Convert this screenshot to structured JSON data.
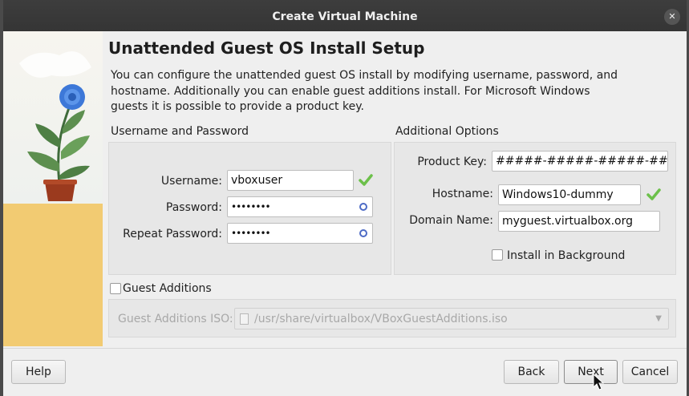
{
  "window": {
    "title": "Create Virtual Machine",
    "close_glyph": "✕"
  },
  "page": {
    "heading": "Unattended Guest OS Install Setup",
    "description": "You can configure the unattended guest OS install by modifying username, password, and hostname. Additionally you can enable guest additions install. For Microsoft Windows guests it is possible to provide a product key."
  },
  "credentials": {
    "section_label": "Username and Password",
    "username_label": "Username:",
    "username_value": "vboxuser",
    "password_label": "Password:",
    "password_value": "••••••••",
    "repeat_password_label": "Repeat Password:",
    "repeat_password_value": "••••••••"
  },
  "additional": {
    "section_label": "Additional Options",
    "product_key_label": "Product Key:",
    "product_key_value": "#####-#####-#####-#####-#",
    "hostname_label": "Hostname:",
    "hostname_value": "Windows10-dummy",
    "domain_label": "Domain Name:",
    "domain_value": "myguest.virtualbox.org",
    "install_background_label": "Install in Background",
    "install_background_checked": false
  },
  "guest_additions": {
    "label": "Guest Additions",
    "checked": false,
    "iso_label": "Guest Additions ISO:",
    "iso_path": "/usr/share/virtualbox/VBoxGuestAdditions.iso"
  },
  "buttons": {
    "help": "Help",
    "back": "Back",
    "next": "Next",
    "cancel": "Cancel"
  },
  "colors": {
    "titlebar": "#383838",
    "valid_check": "#6cc04a",
    "floor": "#f2cb72",
    "flower": "#3d78d8"
  }
}
